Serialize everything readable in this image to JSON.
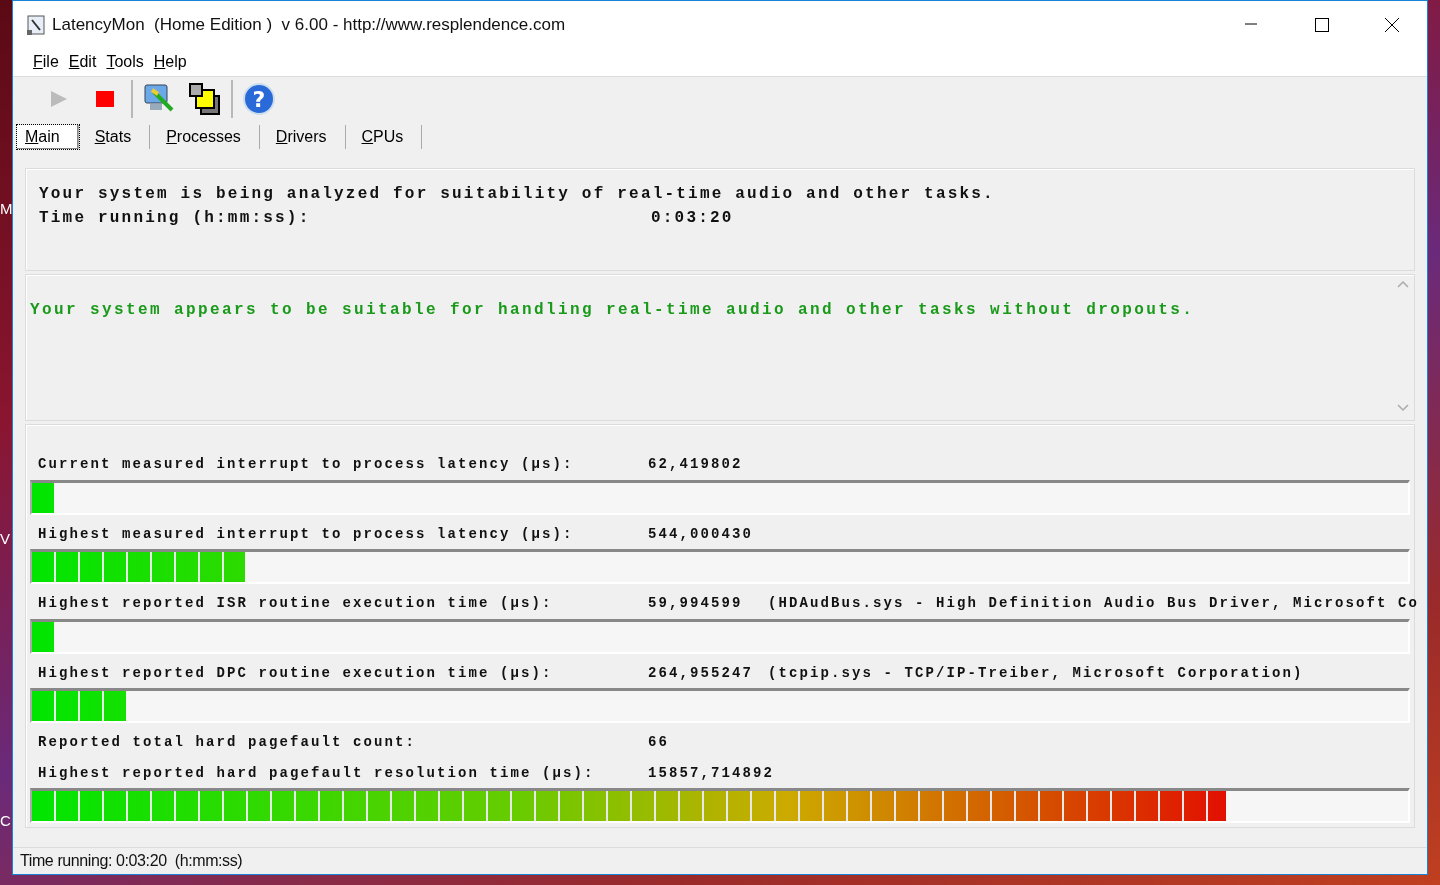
{
  "desktop_labels": [
    "M",
    "V",
    "C"
  ],
  "window": {
    "title": "LatencyMon  (Home Edition )  v 6.00 - http://www.resplendence.com"
  },
  "menu": [
    {
      "label": "File"
    },
    {
      "label": "Edit"
    },
    {
      "label": "Tools"
    },
    {
      "label": "Help"
    }
  ],
  "toolbar": [
    [
      {
        "kind": "play",
        "disabled": true
      },
      {
        "kind": "stop",
        "disabled": false
      }
    ],
    [
      {
        "kind": "drivers",
        "disabled": false
      },
      {
        "kind": "windows",
        "disabled": false
      }
    ],
    [
      {
        "kind": "help",
        "disabled": false,
        "glyph": "?"
      }
    ]
  ],
  "tabs": [
    {
      "label": "Main",
      "selected": true
    },
    {
      "label": "Stats",
      "selected": false
    },
    {
      "label": "Processes",
      "selected": false
    },
    {
      "label": "Drivers",
      "selected": false
    },
    {
      "label": "CPUs",
      "selected": false
    }
  ],
  "analysis": {
    "text": "Your system is being analyzed for suitability of real-time audio and other tasks.",
    "time_label": "Time running (h:mm:ss):",
    "time_value": "0:03:20"
  },
  "verdict": {
    "kind": "ok",
    "text": "Your system appears to be suitable for handling real-time audio and other tasks without dropouts."
  },
  "meters": [
    {
      "kind": "bar",
      "label": "Current measured interrupt to process latency (µs):",
      "value": "62,419802",
      "level": 0.016
    },
    {
      "kind": "bar",
      "label": "Highest measured interrupt to process latency (µs):",
      "value": "544,000430",
      "level": 0.155
    },
    {
      "kind": "bar",
      "label": "Highest reported ISR routine execution time (µs):",
      "value": "59,994599",
      "detail": "(HDAudBus.sys - High Definition Audio Bus Driver, Microsoft Co",
      "level": 0.016
    },
    {
      "kind": "bar",
      "label": "Highest reported DPC routine execution time (µs):",
      "value": "264,955247",
      "detail": "(tcpip.sys - TCP/IP-Treiber, Microsoft Corporation)",
      "level": 0.068
    },
    {
      "kind": "text",
      "label": "Reported total hard pagefault count:",
      "value": "66"
    },
    {
      "kind": "bar",
      "label": "Highest reported hard pagefault resolution time (µs):",
      "value": "15857,714892",
      "level": 0.868
    }
  ],
  "status_bar": "Time running: 0:03:20  (h:mm:ss)"
}
